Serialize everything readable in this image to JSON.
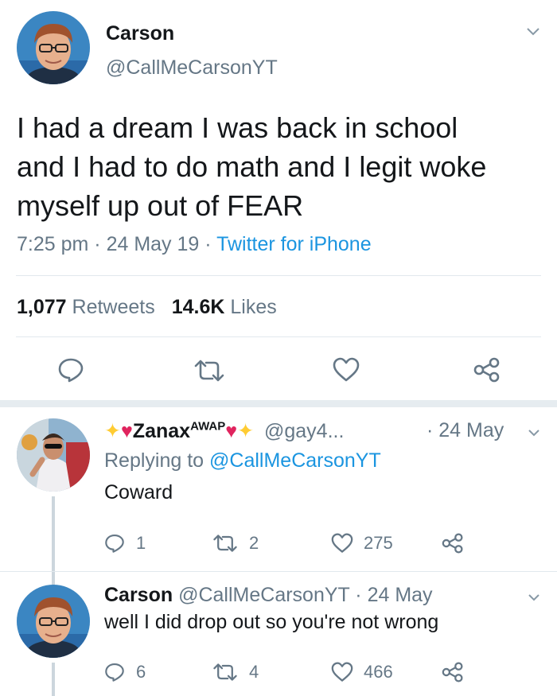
{
  "main_tweet": {
    "author_name": "Carson",
    "author_handle": "@CallMeCarsonYT",
    "text_lines": [
      "I had a dream I was back in school",
      "and I had to do math and I legit woke",
      "myself up out of FEAR"
    ],
    "time": "7:25 pm",
    "date": "24 May 19",
    "source": "Twitter for iPhone",
    "retweets_count": "1,077",
    "retweets_label": "Retweets",
    "likes_count": "14.6K",
    "likes_label": "Likes"
  },
  "replies": [
    {
      "author_name": "Zanax",
      "author_name_sup": "AWAP",
      "author_handle": "@gay4...",
      "date": "24 May",
      "replying_prefix": "Replying to",
      "replying_handle": "@CallMeCarsonYT",
      "text": "Coward",
      "reply_count": "1",
      "retweet_count": "2",
      "like_count": "275"
    },
    {
      "author_name": "Carson",
      "author_handle": "@CallMeCarsonYT",
      "date": "24 May",
      "text": "well I did drop out so you're not wrong",
      "reply_count": "6",
      "retweet_count": "4",
      "like_count": "466"
    }
  ],
  "colors": {
    "link": "#1b95e0",
    "secondary_text": "#657786",
    "divider": "#e1e8ed",
    "heart_emoji": "#e0245e",
    "sparkle_emoji": "#ffcc33"
  }
}
